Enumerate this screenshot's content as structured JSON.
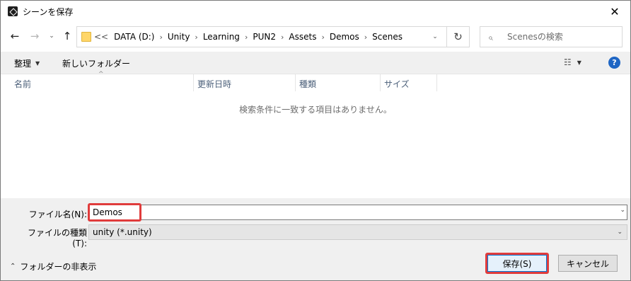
{
  "window": {
    "title": "シーンを保存",
    "close_glyph": "✕"
  },
  "nav": {
    "back_glyph": "←",
    "forward_glyph": "→",
    "recent_glyph": "⌄",
    "up_glyph": "↑"
  },
  "address": {
    "prefix": "<<",
    "crumbs": [
      "DATA (D:)",
      "Unity",
      "Learning",
      "PUN2",
      "Assets",
      "Demos",
      "Scenes"
    ],
    "separator": "›",
    "dropdown_glyph": "⌄",
    "refresh_glyph": "↻"
  },
  "search": {
    "placeholder": "Scenesの検索",
    "icon_glyph": "⌕"
  },
  "toolbar": {
    "organize_label": "整理",
    "organize_caret": "▼",
    "new_folder_label": "新しいフォルダー",
    "view_glyph": "☷",
    "view_caret": "▼",
    "help_glyph": "?"
  },
  "list": {
    "sort_glyph": "^",
    "columns": [
      "名前",
      "更新日時",
      "種類",
      "サイズ"
    ],
    "empty_message": "検索条件に一致する項目はありません。"
  },
  "form": {
    "filename_label": "ファイル名(N):",
    "filename_value": "Demos",
    "filetype_label": "ファイルの種類(T):",
    "filetype_value": "unity (*.unity)",
    "dropdown_glyph": "⌄"
  },
  "footer": {
    "hide_folders_label": "フォルダーの非表示",
    "hide_folders_glyph": "⌃",
    "save_label": "保存(S)",
    "cancel_label": "キャンセル"
  },
  "colors": {
    "highlight": "#e03c3c",
    "accent": "#0078d7",
    "help": "#1f66c4"
  }
}
